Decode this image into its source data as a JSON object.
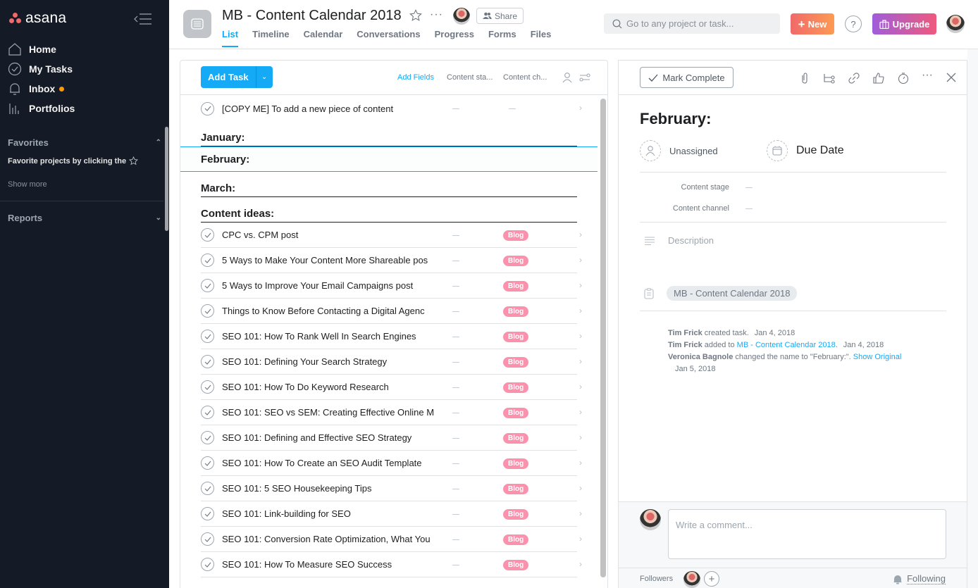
{
  "app": {
    "name": "asana"
  },
  "colors": {
    "accent": "#14aaf5",
    "sidebar_bg": "#151b26",
    "tag_blog": "#fc91ad",
    "inbox_dot": "#fd9a00",
    "new_gradient": [
      "#f06a6a",
      "#fd9a53"
    ],
    "upgrade_gradient": [
      "#a05ddb",
      "#ee5a7d"
    ]
  },
  "sidebar": {
    "nav": [
      {
        "label": "Home",
        "icon": "home-icon"
      },
      {
        "label": "My Tasks",
        "icon": "check-circle-icon"
      },
      {
        "label": "Inbox",
        "icon": "bell-icon",
        "unread": true
      },
      {
        "label": "Portfolios",
        "icon": "bar-chart-icon"
      }
    ],
    "favorites": {
      "title": "Favorites",
      "hint": "Favorite projects by clicking the",
      "show_more": "Show more"
    },
    "reports": {
      "title": "Reports"
    }
  },
  "header": {
    "project_title": "MB - Content Calendar 2018",
    "share_label": "Share",
    "tabs": [
      {
        "label": "List",
        "active": true
      },
      {
        "label": "Timeline"
      },
      {
        "label": "Calendar"
      },
      {
        "label": "Conversations"
      },
      {
        "label": "Progress"
      },
      {
        "label": "Forms"
      },
      {
        "label": "Files"
      }
    ],
    "search_placeholder": "Go to any project or task...",
    "new_label": "New",
    "help_label": "?",
    "upgrade_label": "Upgrade"
  },
  "list": {
    "add_task_label": "Add Task",
    "add_fields_label": "Add Fields",
    "columns": [
      "Content sta...",
      "Content ch..."
    ],
    "first_task": {
      "name": "[COPY ME] To add a new piece of content",
      "stage": "—",
      "channel": "—"
    },
    "sections": [
      "January:",
      "February:",
      "March:",
      "Content ideas:"
    ],
    "tasks": [
      {
        "name": "CPC vs. CPM post",
        "stage": "—",
        "channel": "Blog"
      },
      {
        "name": "5 Ways to Make Your Content More Shareable pos",
        "stage": "—",
        "channel": "Blog"
      },
      {
        "name": "5 Ways to Improve Your Email Campaigns post",
        "stage": "—",
        "channel": "Blog"
      },
      {
        "name": "Things to Know Before Contacting a Digital Agenc",
        "stage": "—",
        "channel": "Blog"
      },
      {
        "name": "SEO 101: How To Rank Well In Search Engines",
        "stage": "—",
        "channel": "Blog"
      },
      {
        "name": "SEO 101: Defining Your Search Strategy",
        "stage": "—",
        "channel": "Blog"
      },
      {
        "name": "SEO 101: How To Do Keyword Research",
        "stage": "—",
        "channel": "Blog"
      },
      {
        "name": "SEO 101: SEO vs SEM: Creating Effective Online M",
        "stage": "—",
        "channel": "Blog"
      },
      {
        "name": "SEO 101: Defining and Effective SEO Strategy",
        "stage": "—",
        "channel": "Blog"
      },
      {
        "name": "SEO 101: How To Create an SEO Audit Template",
        "stage": "—",
        "channel": "Blog"
      },
      {
        "name": "SEO 101: 5 SEO Housekeeping Tips",
        "stage": "—",
        "channel": "Blog"
      },
      {
        "name": "SEO 101: Link-building for SEO",
        "stage": "—",
        "channel": "Blog"
      },
      {
        "name": "SEO 101: Conversion Rate Optimization, What You",
        "stage": "—",
        "channel": "Blog"
      },
      {
        "name": "SEO 101: How To Measure SEO Success",
        "stage": "—",
        "channel": "Blog"
      }
    ]
  },
  "detail": {
    "mark_complete_label": "Mark Complete",
    "title": "February:",
    "assignee": "Unassigned",
    "due_date": "Due Date",
    "fields": [
      {
        "label": "Content stage",
        "value": "—"
      },
      {
        "label": "Content channel",
        "value": "—"
      }
    ],
    "description_placeholder": "Description",
    "project": "MB - Content Calendar 2018",
    "activity": {
      "a1_actor": "Tim Frick",
      "a1_text": "created task.",
      "a1_date": "Jan 4, 2018",
      "a2_actor": "Tim Frick",
      "a2_text": "added to",
      "a2_link": "MB - Content Calendar 2018",
      "a2_date": "Jan 4, 2018",
      "a3_actor": "Veronica Bagnole",
      "a3_text": "changed the name to \"February:\".",
      "a3_link": "Show Original",
      "a3_date": "Jan 5, 2018"
    },
    "comment_placeholder": "Write a comment...",
    "followers_label": "Followers",
    "following_label": "Following"
  }
}
